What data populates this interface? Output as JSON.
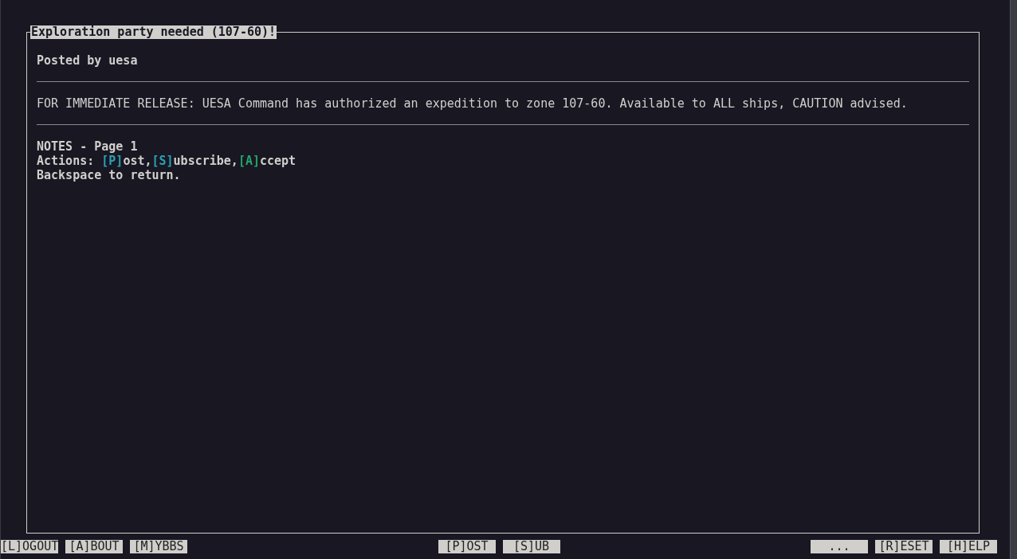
{
  "panel": {
    "title": "Exploration party needed (107-60)!",
    "posted_by": "Posted by uesa",
    "body": "FOR IMMEDIATE RELEASE: UESA Command has authorized an expedition to zone 107-60. Available to ALL ships, CAUTION advised.",
    "notes_heading": "NOTES - Page 1",
    "actions": {
      "label": "Actions: ",
      "items": [
        {
          "key": "[P]",
          "rest": "ost,",
          "color": "#2aa1b3"
        },
        {
          "key": "[S]",
          "rest": "ubscribe,",
          "color": "#2aa1b3"
        },
        {
          "key": "[A]",
          "rest": "ccept",
          "color": "#26a269"
        }
      ]
    },
    "hint": "Backspace to return."
  },
  "menu_bar": {
    "left": [
      "[L]OGOUT",
      "[A]BOUT",
      "[M]YBBS"
    ],
    "center": [
      "[P]OST",
      "[S]UB"
    ],
    "right": [
      "...",
      "[R]ESET",
      "[H]ELP"
    ]
  }
}
